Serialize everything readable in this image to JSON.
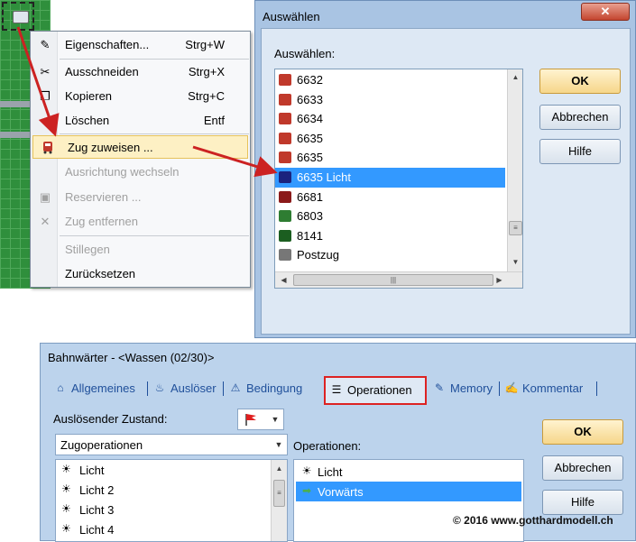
{
  "context_menu": {
    "items": [
      {
        "label": "Eigenschaften...",
        "shortcut": "Strg+W",
        "icon": "properties-icon",
        "glyph": "✎",
        "enabled": true
      },
      {
        "label": "Ausschneiden",
        "shortcut": "Strg+X",
        "icon": "scissors-icon",
        "glyph": "✂",
        "enabled": true
      },
      {
        "label": "Kopieren",
        "shortcut": "Strg+C",
        "icon": "copy-icon",
        "glyph": "❐",
        "enabled": true
      },
      {
        "label": "Löschen",
        "shortcut": "Entf",
        "icon": "",
        "glyph": "",
        "enabled": true
      },
      {
        "label": "Zug zuweisen ...",
        "shortcut": "",
        "icon": "train-icon",
        "glyph": "",
        "enabled": true,
        "highlighted": true
      },
      {
        "label": "Ausrichtung wechseln",
        "shortcut": "",
        "icon": "",
        "glyph": "",
        "enabled": false
      },
      {
        "label": "Reservieren ...",
        "shortcut": "",
        "icon": "reserve-icon",
        "glyph": "▣",
        "enabled": false
      },
      {
        "label": "Zug entfernen",
        "shortcut": "",
        "icon": "remove-train-icon",
        "glyph": "✕",
        "enabled": false
      },
      {
        "label": "Stillegen",
        "shortcut": "",
        "icon": "",
        "glyph": "",
        "enabled": false
      },
      {
        "label": "Zurücksetzen",
        "shortcut": "",
        "icon": "",
        "glyph": "",
        "enabled": true
      }
    ]
  },
  "select_dialog": {
    "title": "Auswählen",
    "close_glyph": "✕",
    "list_label": "Auswählen:",
    "items": [
      {
        "label": "6632",
        "color": "#c0392b"
      },
      {
        "label": "6633",
        "color": "#c0392b"
      },
      {
        "label": "6634",
        "color": "#c0392b"
      },
      {
        "label": "6635",
        "color": "#c0392b"
      },
      {
        "label": "6635",
        "color": "#c0392b"
      },
      {
        "label": "6635 Licht",
        "color": "#1a237e",
        "selected": true
      },
      {
        "label": "6681",
        "color": "#8b1a1a"
      },
      {
        "label": "6803",
        "color": "#2e7d32"
      },
      {
        "label": "8141",
        "color": "#1b5e20"
      },
      {
        "label": "Postzug",
        "color": "#777777"
      }
    ],
    "buttons": {
      "ok": "OK",
      "cancel": "Abbrechen",
      "help": "Hilfe"
    }
  },
  "bahnwaerter": {
    "title": "Bahnwärter - <Wassen (02/30)>",
    "tabs": [
      {
        "label": "Allgemeines",
        "icon": "general-icon",
        "glyph": "⌂"
      },
      {
        "label": "Auslöser",
        "icon": "trigger-icon",
        "glyph": "♨"
      },
      {
        "label": "Bedingung",
        "icon": "condition-icon",
        "glyph": "⚠"
      },
      {
        "label": "Operationen",
        "icon": "operations-icon",
        "glyph": "☰",
        "active": true
      },
      {
        "label": "Memory",
        "icon": "memory-icon",
        "glyph": "✎"
      },
      {
        "label": "Kommentar",
        "icon": "comment-icon",
        "glyph": "✍"
      }
    ],
    "trigger_label": "Auslösender Zustand:",
    "zug_select": "Zugoperationen",
    "left_items": [
      "Licht",
      "Licht 2",
      "Licht 3",
      "Licht 4"
    ],
    "operations_label": "Operationen:",
    "operations": [
      {
        "label": "Licht",
        "icon": "light-icon",
        "glyph": "☀"
      },
      {
        "label": "Vorwärts",
        "icon": "forward-arrow-icon",
        "glyph": "➡",
        "selected": true
      }
    ],
    "buttons": {
      "ok": "OK",
      "cancel": "Abbrechen",
      "help": "Hilfe"
    }
  },
  "copyright": "© 2016 www.gotthardmodell.ch",
  "colors": {
    "accent": "#3399ff",
    "arrow": "#cc2222",
    "highlight_box": "#dd2222"
  }
}
